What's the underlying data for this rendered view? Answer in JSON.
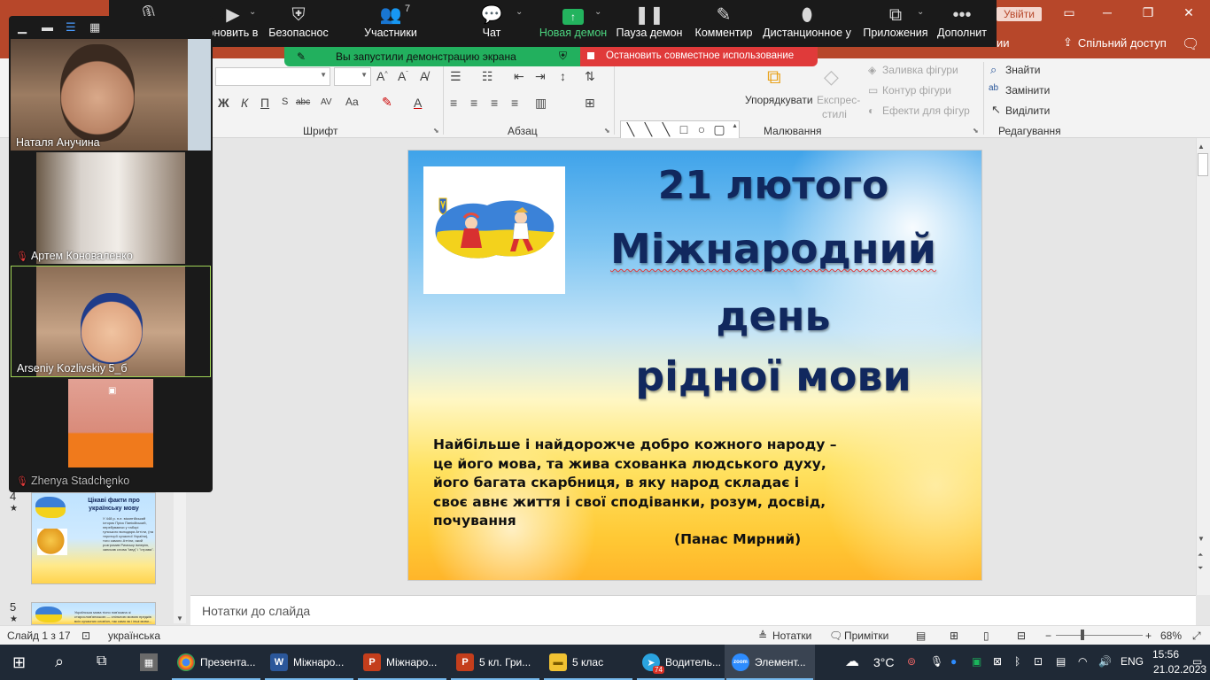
{
  "powerpoint": {
    "signin_label": "Увійти",
    "share_label": "Спільний доступ",
    "tabs_partial": "ии",
    "ribbon": {
      "font_group_label": "Шрифт",
      "paragraph_group_label": "Абзац",
      "drawing_group_label": "Малювання",
      "editing_group_label": "Редагування",
      "font_buttons": [
        "Ж",
        "К",
        "П",
        "abc",
        "AV",
        "Aa",
        "A"
      ],
      "arrange_label": "Упорядкувати",
      "quick_styles_line1": "Експрес-",
      "quick_styles_line2": "стилі",
      "shape_fill_label": "Заливка фігури",
      "shape_outline_label": "Контур фігури",
      "shape_effects_label": "Ефекти для фігур",
      "find_label": "Знайти",
      "replace_label": "Замінити",
      "select_label": "Виділити"
    },
    "thumbnails": [
      {
        "number": "4",
        "title": "Цікаві факти про українську мову",
        "text": "У 448 р. н.е. візантійський історик Пріск Панікійський, перебуваючи у таборі гунського володаря Аттіли, (на території сучасної України), того самого Аттіли, який розгромив Римську імперію, записав слова \"мед\" і \"страва\"."
      },
      {
        "number": "5",
        "title": "",
        "text": "Українська мова тісно пов'язана зі старослов'янською — спільною мовою предків всіх сучасних слов'ян, так само як і інші мови..."
      }
    ],
    "slide": {
      "title_line1": "21 лютого",
      "title_line2": "Міжнародний",
      "title_line3": "день",
      "title_line4": "рідної мови",
      "quote_line1": "Найбільше і найдорожче добро кожного народу –",
      "quote_line2": "це його мова, та жива схованка людського духу,",
      "quote_line3": "його багата скарбниця, в яку народ складає і",
      "quote_line4": "своє авнє життя і свої сподіванки, розум, досвід,",
      "quote_line5": "почування",
      "author": "(Панас Мирний)"
    },
    "notes_placeholder": "Нотатки до слайда",
    "status": {
      "slide_counter": "Слайд 1 з 17",
      "language": "українська",
      "notes_label": "Нотатки",
      "comments_label": "Примітки",
      "zoom_level": "68%"
    }
  },
  "zoom": {
    "toolbar": [
      {
        "name": "mute",
        "label": ""
      },
      {
        "name": "video",
        "label": "оновить в"
      },
      {
        "name": "security",
        "label": "Безопаснос"
      },
      {
        "name": "participants",
        "label": "Участники",
        "count": "7"
      },
      {
        "name": "chat",
        "label": "Чат"
      },
      {
        "name": "new-share",
        "label": "Новая демон"
      },
      {
        "name": "pause-share",
        "label": "Пауза демон"
      },
      {
        "name": "annotate",
        "label": "Комментир"
      },
      {
        "name": "remote-control",
        "label": "Дистанционное у"
      },
      {
        "name": "apps",
        "label": "Приложения"
      },
      {
        "name": "more",
        "label": "Дополнит"
      }
    ],
    "share_status": "Вы запустили демонстрацию экрана",
    "stop_share": "Остановить совместное использование",
    "participants": [
      {
        "name": "Наталя Анучина",
        "muted": false
      },
      {
        "name": "Артем Коноваленко",
        "muted": true
      },
      {
        "name": "Arseniy Kozlivskiy 5_б",
        "muted": false
      },
      {
        "name": "Zhenya Stadchenko",
        "muted": true
      }
    ]
  },
  "taskbar": {
    "apps": [
      {
        "name": "chrome",
        "label": "Презента..."
      },
      {
        "name": "word",
        "label": "Міжнаро..."
      },
      {
        "name": "powerpoint-1",
        "label": "Міжнаро..."
      },
      {
        "name": "powerpoint-2",
        "label": "5 кл. Гри..."
      },
      {
        "name": "explorer",
        "label": "5 клас"
      },
      {
        "name": "telegram",
        "label": "Водитель...",
        "badge": "74"
      },
      {
        "name": "zoom",
        "label": "Элемент..."
      }
    ],
    "weather": "3°C",
    "language": "ENG",
    "time": "15:56",
    "date": "21.02.2023"
  }
}
